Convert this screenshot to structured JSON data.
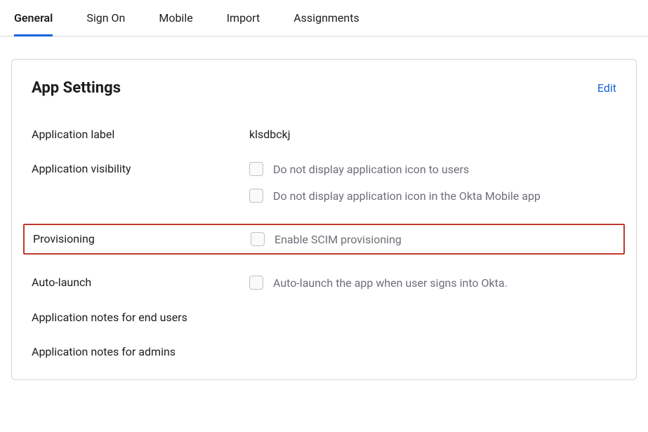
{
  "tabs": [
    {
      "label": "General",
      "active": true
    },
    {
      "label": "Sign On",
      "active": false
    },
    {
      "label": "Mobile",
      "active": false
    },
    {
      "label": "Import",
      "active": false
    },
    {
      "label": "Assignments",
      "active": false
    }
  ],
  "card": {
    "title": "App Settings",
    "edit_label": "Edit",
    "fields": {
      "application_label": {
        "label": "Application label",
        "value": "klsdbckj"
      },
      "application_visibility": {
        "label": "Application visibility",
        "options": [
          "Do not display application icon to users",
          "Do not display application icon in the Okta Mobile app"
        ]
      },
      "provisioning": {
        "label": "Provisioning",
        "options": [
          "Enable SCIM provisioning"
        ]
      },
      "auto_launch": {
        "label": "Auto-launch",
        "options": [
          "Auto-launch the app when user signs into Okta."
        ]
      },
      "notes_users": {
        "label": "Application notes for end users"
      },
      "notes_admins": {
        "label": "Application notes for admins"
      }
    }
  }
}
